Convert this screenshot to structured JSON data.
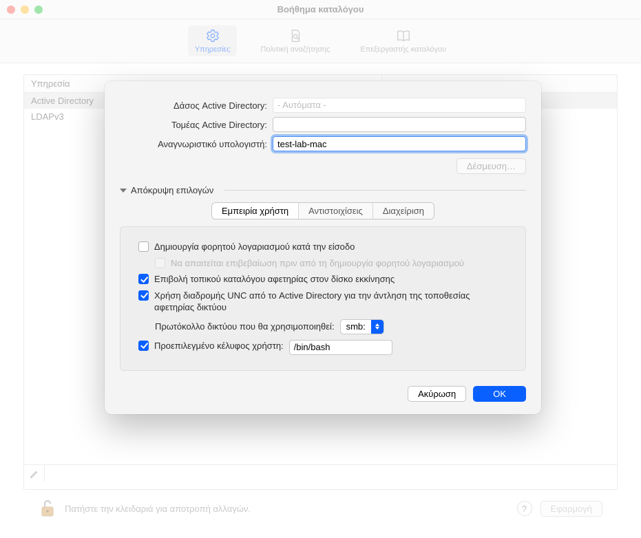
{
  "window": {
    "title": "Βοήθημα καταλόγου"
  },
  "toolbar": {
    "services": "Υπηρεσίες",
    "search_policy": "Πολιτική αναζήτησης",
    "directory_editor": "Επεξεργαστής καταλόγου"
  },
  "table": {
    "header_service": "Υπηρεσία",
    "rows": [
      "Active Directory",
      "LDAPv3"
    ]
  },
  "bottombar": {
    "lock_text": "Πατήστε την κλειδαριά για αποτροπή αλλαγών.",
    "help": "?",
    "apply": "Εφαρμογή"
  },
  "sheet": {
    "forest_label": "Δάσος Active Directory:",
    "forest_placeholder": "- Αυτόματα -",
    "domain_label": "Τομέας Active Directory:",
    "computer_id_label": "Αναγνωριστικό υπολογιστή:",
    "computer_id_value": "test-lab-mac",
    "bind_button": "Δέσμευση…",
    "disclosure": "Απόκρυψη επιλογών",
    "tabs": {
      "ux": "Εμπειρία χρήστη",
      "mappings": "Αντιστοιχίσεις",
      "admin": "Διαχείριση"
    },
    "opts": {
      "mobile": "Δημιουργία φορητού λογαριασμού κατά την είσοδο",
      "confirm": "Να απαιτείται επιβεβαίωση πριν από τη δημιουργία φορητού λογαριασμού",
      "force_local": "Επιβολή τοπικού καταλόγου αφετηρίας στον δίσκο εκκίνησης",
      "use_unc": "Χρήση διαδρομής UNC από το Active Directory για την άντληση της τοποθεσίας αφετηρίας δικτύου",
      "proto_label": "Πρωτόκολλο δικτύου που θα χρησιμοποιηθεί:",
      "proto_value": "smb:",
      "shell": "Προεπιλεγμένο κέλυφος χρήστη:",
      "shell_value": "/bin/bash"
    },
    "cancel": "Ακύρωση",
    "ok": "OK"
  }
}
